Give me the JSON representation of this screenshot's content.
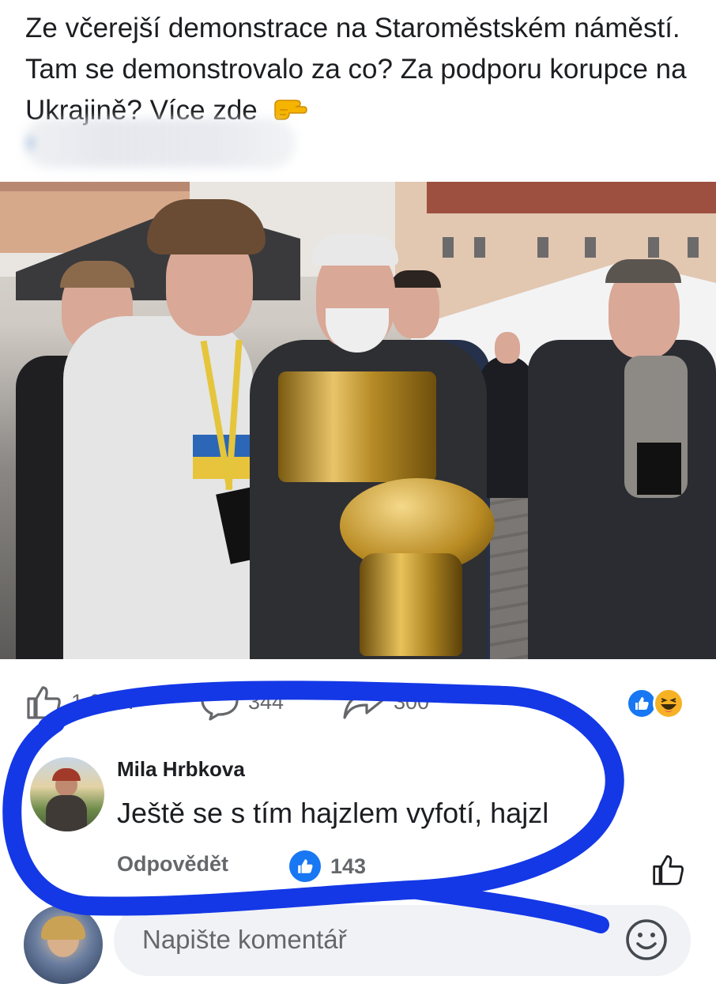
{
  "post": {
    "text": "Ze včerejší demonstrace na Staroměstském náměstí. Tam se demonstrovalo za co? Za podporu korupce na Ukrajině? Více zde",
    "pointing_emoji": "pointing-right-hand"
  },
  "stats": {
    "likes": "1,6 tis.",
    "comments": "344",
    "shares": "300"
  },
  "reactions": [
    "like",
    "haha"
  ],
  "comment": {
    "author": "Mila Hrbkova",
    "text": "Ještě se s tím hajzlem vyfotí, hajzl",
    "reply_label": "Odpovědět",
    "likes": "143"
  },
  "composer": {
    "placeholder": "Napište komentář"
  },
  "colors": {
    "fb_blue": "#1877f2",
    "annotation_ring": "#1438e6",
    "muted_text": "#65676b"
  }
}
